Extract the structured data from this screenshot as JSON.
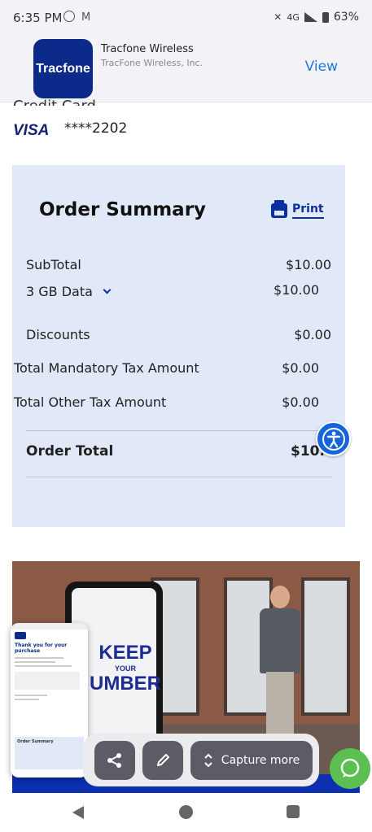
{
  "status_bar": {
    "time": "6:35 PM",
    "network": "4G",
    "battery": "63%"
  },
  "app_banner": {
    "app_name": "Tracfone Wireless",
    "publisher": "TracFone Wireless, Inc.",
    "logo_text": "Tracfone",
    "action": "View"
  },
  "payment": {
    "section_title_cut": "Credit Card",
    "card_brand": "VISA",
    "card_last4": "****2202"
  },
  "order_summary": {
    "title": "Order Summary",
    "print_label": "Print",
    "rows": [
      {
        "label": "SubTotal",
        "value": "$10.00"
      },
      {
        "label": "3 GB Data",
        "value": "$10.00"
      },
      {
        "label": "Discounts",
        "value": "$0.00"
      },
      {
        "label": "Total Mandatory Tax Amount",
        "value": "$0.00"
      },
      {
        "label": "Total Other Tax Amount",
        "value": "$0.00"
      }
    ],
    "total_label": "Order Total",
    "total_value": "$10.0"
  },
  "video": {
    "headline": "KEEP",
    "sub": "YOUR",
    "headline2": "UMBER"
  },
  "thumbnail": {
    "title": "Thank you for your purchase",
    "summary_label": "Order Summary"
  },
  "toolbar": {
    "capture_label": "Capture more"
  },
  "colors": {
    "brand_blue": "#0b2fa0",
    "summary_bg": "#e1e8f7",
    "accessibility": "#1565d8",
    "chat": "#5cbf52"
  },
  "icons": [
    "alarm-icon",
    "mail-icon",
    "mute-icon",
    "signal-icon",
    "battery-icon",
    "printer-icon",
    "chevron-down-icon",
    "accessibility-icon",
    "share-icon",
    "edit-icon",
    "expand-icon",
    "chat-icon",
    "back-icon",
    "home-icon",
    "recents-icon"
  ]
}
